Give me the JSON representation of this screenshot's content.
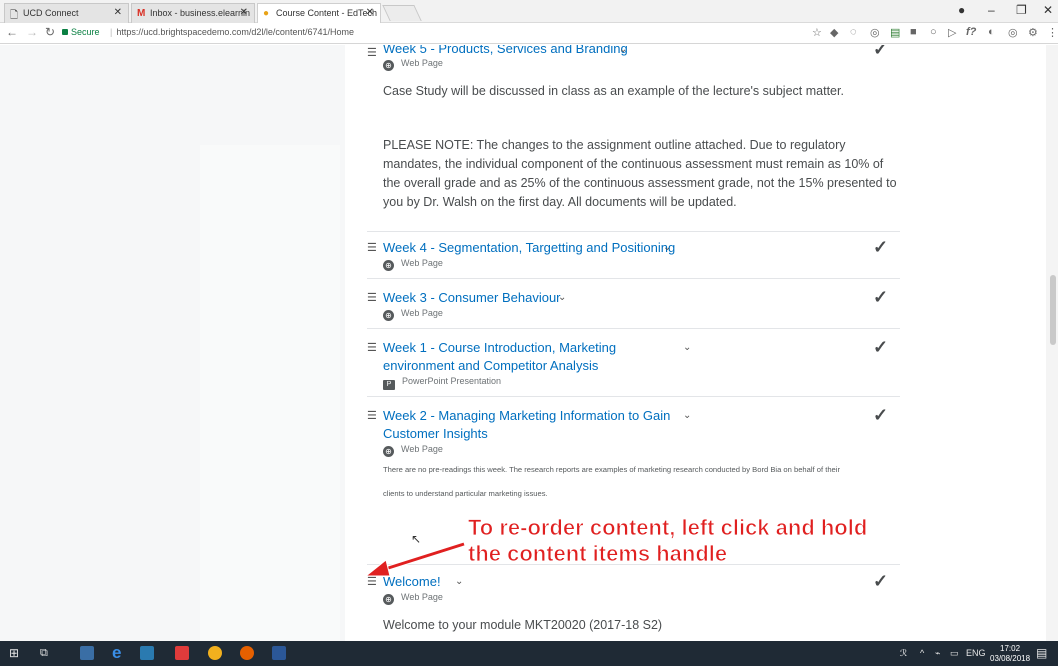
{
  "browser": {
    "tabs": [
      {
        "label": "UCD Connect",
        "icon": "page-icon"
      },
      {
        "label": "Inbox - business.elearnin",
        "icon": "gmail-icon"
      },
      {
        "label": "Course Content - EdTech",
        "icon": "d2l-icon",
        "active": true
      }
    ],
    "secure_label": "Secure",
    "url": "https://ucd.brightspacedemo.com/d2l/le/content/6741/Home"
  },
  "content": {
    "items": [
      {
        "title": "Week 5 - Products, Services and Branding",
        "type": "Web Page",
        "desc1": "Case Study will be discussed in class as an example of the lecture's subject matter.",
        "desc2": "PLEASE NOTE:  The changes to the assignment outline attached.  Due to regulatory mandates, the individual component of the continuous assessment must remain as 10% of the overall grade and as 25% of the continuous assessment grade, not the 15% presented to you by Dr. Walsh on the first day.  All documents will be updated."
      },
      {
        "title": "Week 4 - Segmentation, Targetting and Positioning",
        "type": "Web Page"
      },
      {
        "title": "Week 3 - Consumer Behaviour",
        "type": "Web Page"
      },
      {
        "title_line1": "Week 1 - Course Introduction, Marketing",
        "title_line2": "environment and Competitor Analysis",
        "type": "PowerPoint Presentation"
      },
      {
        "title_line1": "Week 2 - Managing Marketing Information to Gain",
        "title_line2": "Customer Insights",
        "type": "Web Page",
        "note_line1": "There are no pre-readings this week. The research reports are examples of marketing research conducted by Bord Bia on behalf of their",
        "note_line2": "clients to understand particular marketing issues."
      },
      {
        "title": "Welcome!",
        "type": "Web Page",
        "desc": "Welcome to your module MKT20020 (2017-18 S2)"
      }
    ]
  },
  "annotation": {
    "line1": "To re-order content, left click and hold",
    "line2": "the content items handle"
  },
  "taskbar": {
    "lang": "ENG",
    "time": "17:02",
    "date": "03/08/2018"
  },
  "colors": {
    "link": "#006fbf",
    "annotation": "#e02020",
    "taskbar": "#1f2a35"
  }
}
